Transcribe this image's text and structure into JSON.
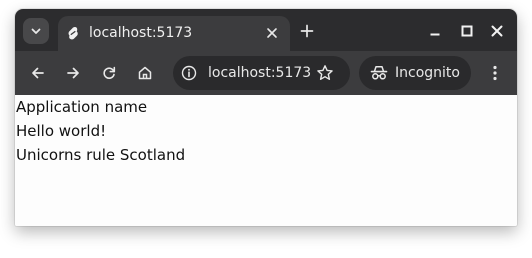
{
  "browser": {
    "tab": {
      "title": "localhost:5173"
    },
    "address_bar": {
      "url": "localhost:5173"
    },
    "incognito_label": "Incognito"
  },
  "page": {
    "lines": [
      "Application name",
      "Hello world!",
      "Unicorns rule Scotland"
    ]
  },
  "icons": {
    "tab_search": "chevron-down-icon",
    "favicon": "svelte-logo-icon",
    "tab_close": "close-icon",
    "new_tab": "plus-icon",
    "minimize": "minimize-icon",
    "maximize": "maximize-icon",
    "close_window": "close-icon",
    "back": "arrow-left-icon",
    "forward": "arrow-right-icon",
    "reload": "reload-icon",
    "home": "home-icon",
    "site_info": "info-icon",
    "bookmark": "star-icon",
    "incognito": "incognito-icon",
    "menu": "more-vertical-icon"
  },
  "colors": {
    "titlebar": "#2c2c2e",
    "toolbar": "#3c3c3e",
    "omnibox": "#2a2a2c",
    "page_background": "#fdfdfd",
    "text": "#111111"
  }
}
